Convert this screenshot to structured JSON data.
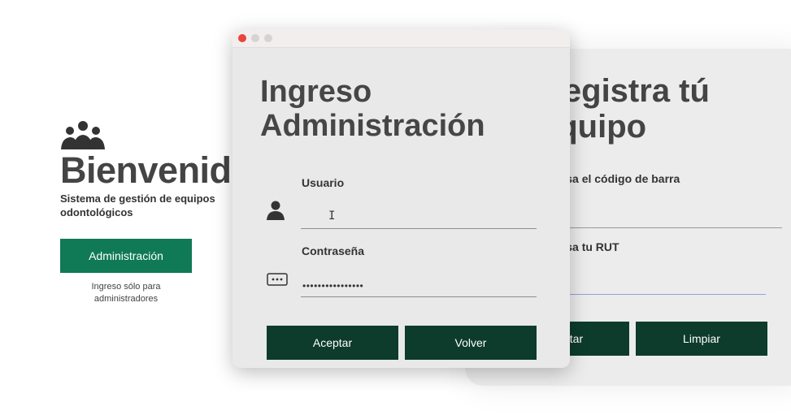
{
  "welcome": {
    "title": "Bienvenido",
    "subtitle": "Sistema de gestión de equipos odontológicos",
    "admin_button_label": "Administración",
    "admin_note": "Ingreso sólo para administradores"
  },
  "background_window": {
    "title_line1": "Registra tú",
    "title_line2": "equipo",
    "barcode_label": "Ingresa el código de barra",
    "rut_label": "Ingresa tu RUT",
    "accept_button_label": "Aceptar",
    "clear_button_label": "Limpiar"
  },
  "dialog": {
    "title_line1": "Ingreso",
    "title_line2": "Administración",
    "username_label": "Usuario",
    "username_value": "",
    "password_label": "Contraseña",
    "password_value": "••••••••••••••••",
    "accept_button_label": "Aceptar",
    "back_button_label": "Volver",
    "text_cursor": "I"
  },
  "colors": {
    "admin_green": "#0f7a55",
    "dark_green": "#0d3b2c",
    "close_red": "#e8453c"
  },
  "icons": {
    "users": "users-icon",
    "user": "user-icon",
    "password": "password-icon"
  }
}
